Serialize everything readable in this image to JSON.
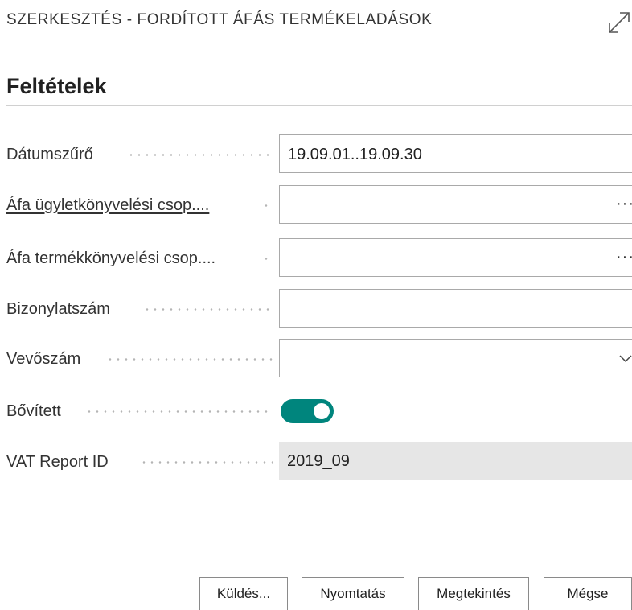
{
  "header": {
    "title": "SZERKESZTÉS - FORDÍTOTT ÁFÁS TERMÉKELADÁSOK",
    "expand_icon": "expand-arrows-icon"
  },
  "section": {
    "title": "Feltételek"
  },
  "fields": [
    {
      "label": "Dátumszűrő",
      "value": "19.09.01..19.09.30",
      "type": "text"
    },
    {
      "label": "Áfa ügyletkönyvelési csop....",
      "value": "",
      "type": "lookup",
      "assist": "···"
    },
    {
      "label": "Áfa termékkönyvelési csop....",
      "value": "",
      "type": "lookup",
      "assist": "···"
    },
    {
      "label": "Bizonylatszám",
      "value": "",
      "type": "text"
    },
    {
      "label": "Vevőszám",
      "value": "",
      "type": "dropdown"
    },
    {
      "label": "Bővített",
      "value": true,
      "type": "toggle"
    },
    {
      "label": "VAT Report ID",
      "value": "2019_09",
      "type": "readonly"
    }
  ],
  "buttons": {
    "send": "Küldés...",
    "print": "Nyomtatás",
    "preview": "Megtekintés",
    "cancel": "Mégse"
  },
  "colors": {
    "toggle_on": "#00857d",
    "readonly_bg": "#e6e6e6",
    "border": "#a9a9a9"
  }
}
